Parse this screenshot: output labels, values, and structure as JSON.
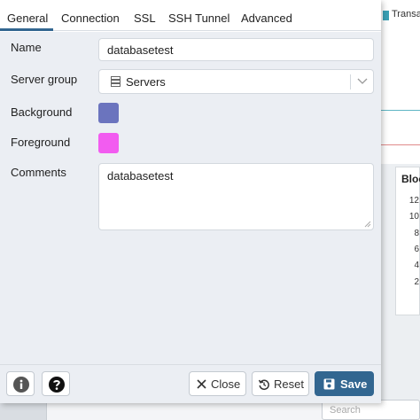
{
  "background_app": {
    "legend_label": "Transa",
    "card_title": "Bloc",
    "axis_ticks": [
      "12",
      "10",
      "8",
      "6",
      "4",
      "2"
    ],
    "search_placeholder": "Search"
  },
  "tabs": [
    {
      "label": "General",
      "active": true
    },
    {
      "label": "Connection",
      "active": false
    },
    {
      "label": "SSL",
      "active": false
    },
    {
      "label": "SSH Tunnel",
      "active": false
    },
    {
      "label": "Advanced",
      "active": false
    }
  ],
  "form": {
    "name_label": "Name",
    "name_value": "databasetest",
    "server_group_label": "Server group",
    "server_group_value": "Servers",
    "background_label": "Background",
    "background_color": "#6b74be",
    "foreground_label": "Foreground",
    "foreground_color": "#f25cf0",
    "comments_label": "Comments",
    "comments_value": "databasetest"
  },
  "footer": {
    "info_icon": "info-icon",
    "help_icon": "help-icon",
    "close_label": "Close",
    "reset_label": "Reset",
    "save_label": "Save"
  },
  "colors": {
    "accent": "#326690",
    "panel_bg": "#ebeef3"
  }
}
